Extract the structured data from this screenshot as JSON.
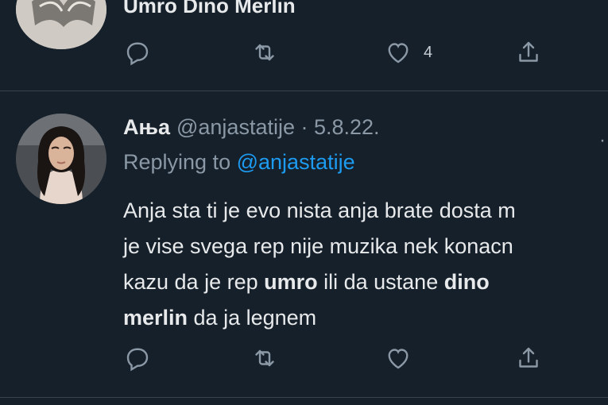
{
  "previous_tweet": {
    "text": "Umro Dino Merlin",
    "actions": {
      "like_count": "4"
    }
  },
  "tweet": {
    "display_name": "Ања",
    "handle": "@anjastatije",
    "date": "· 5.8.22.",
    "replying_prefix": "Replying to",
    "replying_handle": "@anjastatije",
    "lines": [
      [
        "Anja sta ti je evo nista anja brate dosta m"
      ],
      [
        "je vise svega rep nije muzika nek konacn"
      ],
      [
        "kazu da je rep ",
        "umro",
        " ili da ustane ",
        "dino"
      ],
      [
        "merlin",
        " da ja legnem"
      ]
    ]
  },
  "icons": {
    "reply": "reply-icon",
    "retweet": "retweet-icon",
    "like": "heart-icon",
    "share": "share-icon"
  },
  "colors": {
    "background": "#15202b",
    "text": "#e7e9ea",
    "muted": "#8b98a5",
    "link": "#1d9bf0",
    "divider": "#38444d"
  }
}
